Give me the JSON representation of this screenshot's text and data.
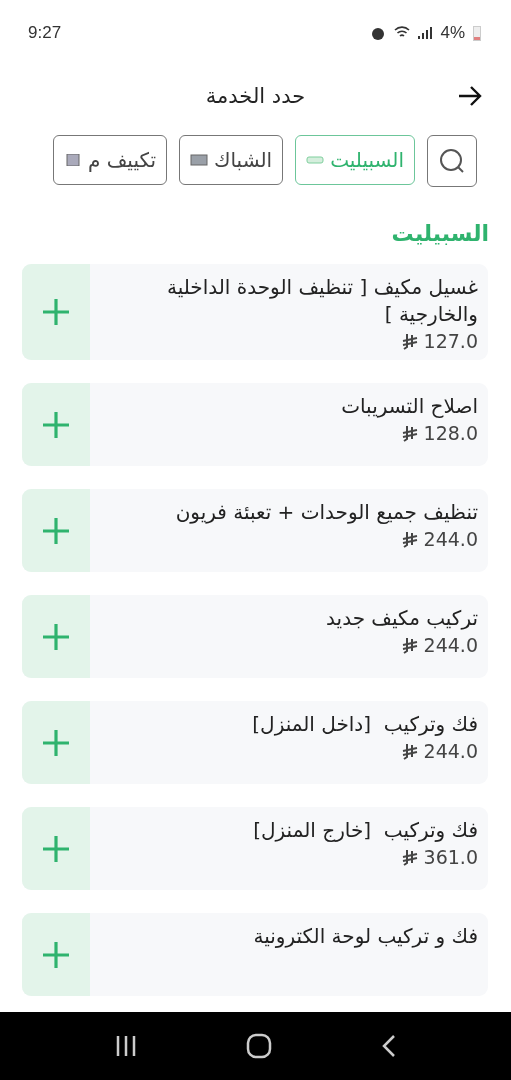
{
  "status_bar": {
    "time": "9:27",
    "battery": "4%"
  },
  "header": {
    "title": "حدد الخدمة"
  },
  "tabs": [
    {
      "kind": "search",
      "selected": false
    },
    {
      "kind": "category",
      "label": "السبيليت",
      "selected": true
    },
    {
      "kind": "category",
      "label": "الشباك",
      "selected": false
    },
    {
      "kind": "category",
      "label": "تكييف م",
      "selected": false
    }
  ],
  "section_title": "السبيليت",
  "services": [
    {
      "name": "غسيل مكيف [ تنظيف الوحدة الداخلية والخارجية ]",
      "price": "127.0"
    },
    {
      "name": "اصلاح التسريبات",
      "price": "128.0"
    },
    {
      "name": "تنظيف جميع الوحدات + تعبئة فريون",
      "price": "244.0"
    },
    {
      "name": "تركيب مكيف جديد",
      "price": "244.0"
    },
    {
      "name": "فك وتركيب  [داخل المنزل]",
      "price": "244.0"
    },
    {
      "name": "فك وتركيب  [خارج المنزل]",
      "price": "361.0"
    },
    {
      "name": "فك و تركيب لوحة الكترونية"
    }
  ]
}
